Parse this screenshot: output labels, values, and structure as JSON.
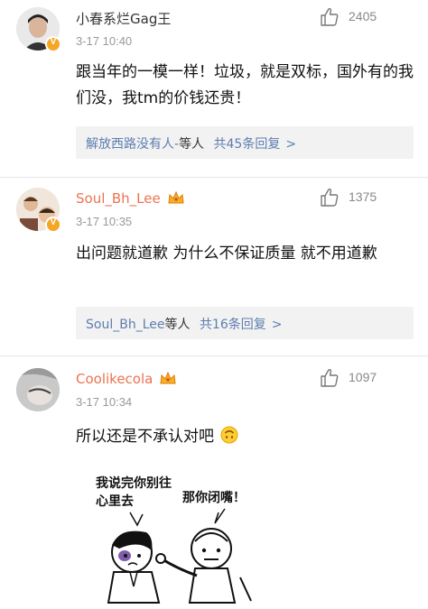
{
  "comments": [
    {
      "username": "小春系烂Gag王",
      "time": "3-17 10:40",
      "likes": "2405",
      "text": "跟当年的一模一样！垃圾，就是双标，国外有的我们没，我tm的价钱还贵！",
      "reply": {
        "names": "解放西路没有人-",
        "suffix": "等人",
        "count": "共45条回复",
        "chevron": ">"
      }
    },
    {
      "username": "Soul_Bh_Lee",
      "time": "3-17 10:35",
      "likes": "1375",
      "text": "出问题就道歉 为什么不保证质量 就不用道歉",
      "reply": {
        "names": "Soul_Bh_Lee",
        "suffix": "等人",
        "count": "共16条回复",
        "chevron": ">"
      }
    },
    {
      "username": "Coolikecola",
      "time": "3-17 10:34",
      "likes": "1097",
      "text": "所以还是不承认对吧",
      "meme": {
        "left_bubble": "我说完你别往心里去",
        "right_bubble": "那你闭嘴！"
      }
    }
  ],
  "colors": {
    "username_vip": "#eb7350",
    "reply_link": "#5d7eb0",
    "reply_bg": "#f2f2f2",
    "meta_gray": "#999999",
    "badge": "#f5a623"
  },
  "icons": [
    "thumbs-up-icon",
    "crown-icon",
    "verified-badge-icon",
    "upside-down-smile-emoji"
  ]
}
